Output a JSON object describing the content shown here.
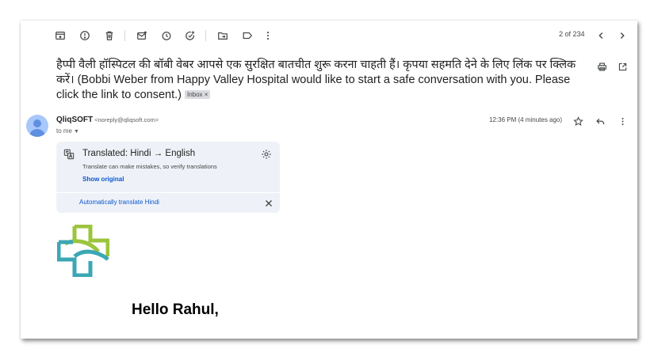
{
  "toolbar": {
    "archive_icon": "archive-icon",
    "report_icon": "report-spam-icon",
    "delete_icon": "trash-icon",
    "unread_icon": "mark-unread-icon",
    "snooze_icon": "snooze-icon",
    "task_icon": "add-task-icon",
    "move_icon": "move-to-folder-icon",
    "label_icon": "label-icon",
    "more_icon": "more-vertical-icon",
    "pager_text": "2 of 234"
  },
  "email": {
    "subject": "हैप्पी वैली हॉस्पिटल की बॉबी वेबर आपसे एक सुरक्षित बातचीत शुरू करना चाहती हैं। कृपया सहमति देने के लिए लिंक पर क्लिक करें। (Bobbi Weber from Happy Valley Hospital would like to start a safe conversation with you. Please click the link to consent.)",
    "label_badge": "Inbox ×",
    "sender_name": "QliqSOFT",
    "sender_email": "<noreply@qliqsoft.com>",
    "recipient": "to me",
    "timestamp": "12:36 PM (4 minutes ago)",
    "greeting": "Hello Rahul,"
  },
  "translation": {
    "title": "Translated: Hindi → English",
    "warning": "Translate can make mistakes, so verify translations",
    "show_original": "Show original",
    "auto_translate": "Automatically translate Hindi"
  },
  "colors": {
    "link": "#0b57d0",
    "card_bg": "#eef2f8",
    "logo_green": "#9cc43c",
    "logo_teal": "#3ba7b4"
  }
}
